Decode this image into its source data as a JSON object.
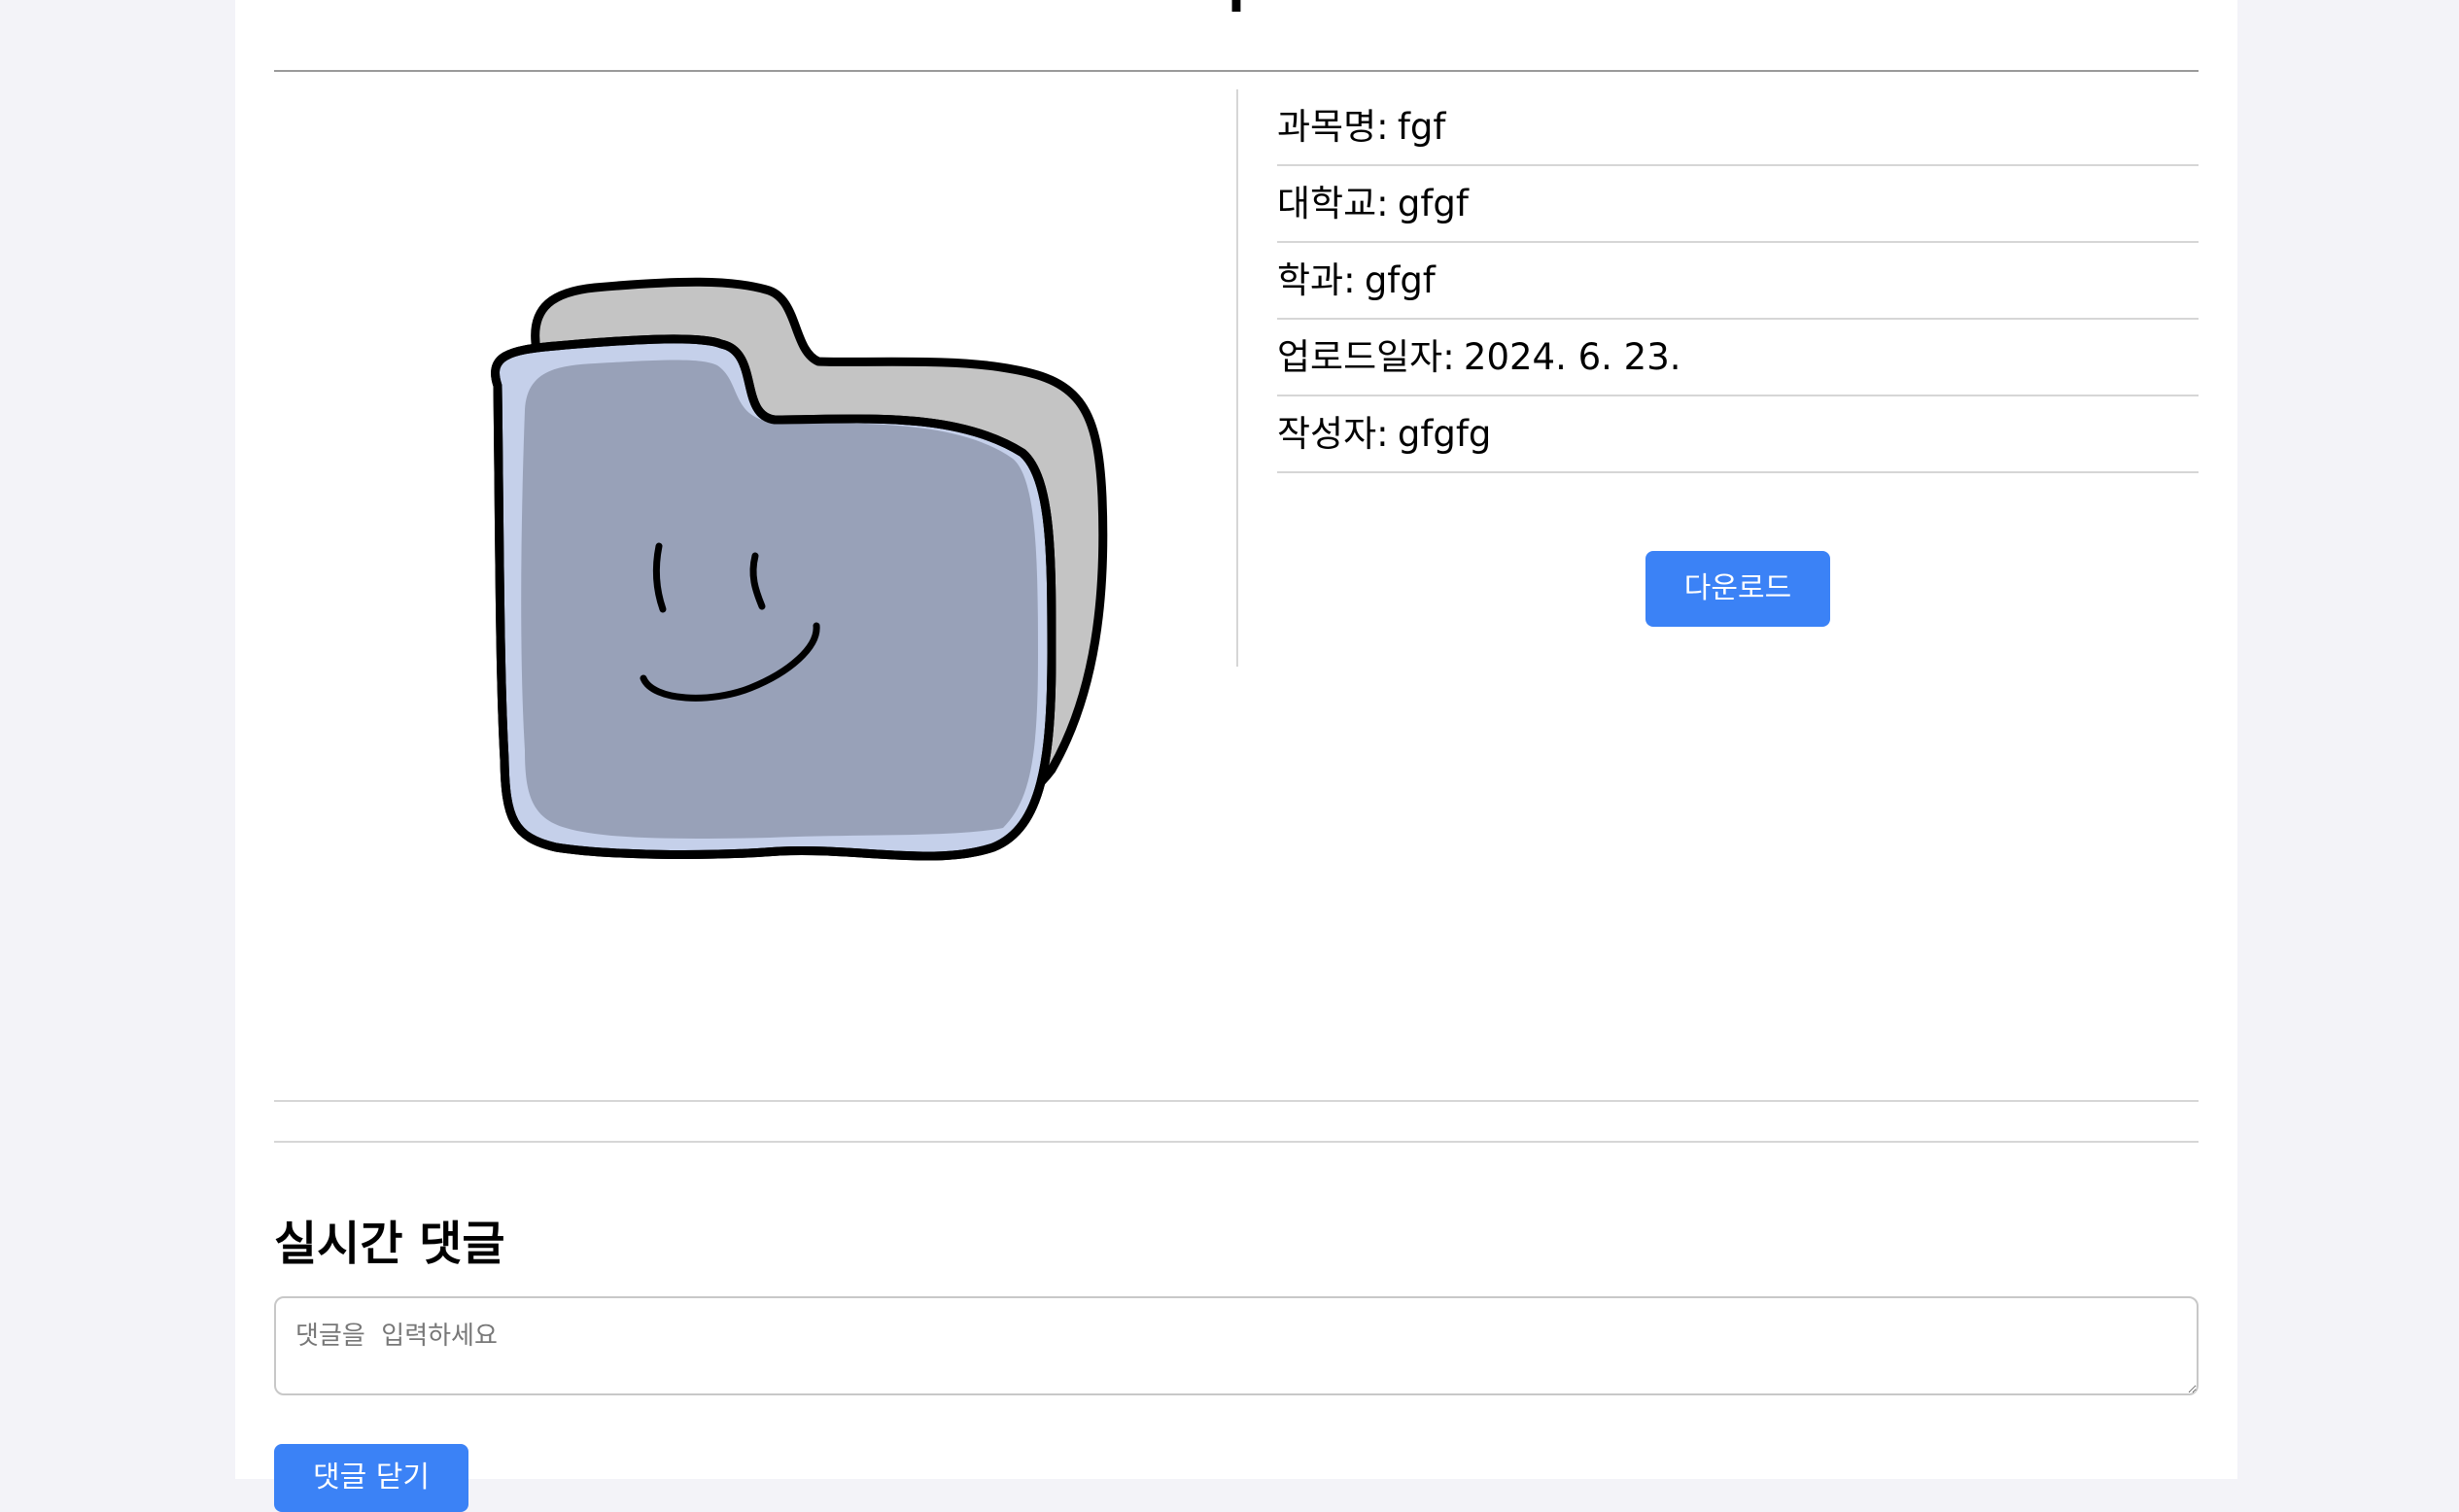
{
  "page": {
    "title": "|"
  },
  "preview": {
    "icon": "smiling-folder-icon",
    "colors": {
      "back": "#c4c4c4",
      "front": "#c5d0ea",
      "inner": "#98a1b8",
      "outline": "#000000"
    }
  },
  "details": {
    "rows": [
      {
        "label": "과목명",
        "value": "fgf"
      },
      {
        "label": "대학교",
        "value": "gfgf"
      },
      {
        "label": "학과",
        "value": "gfgf"
      },
      {
        "label": "업로드일자",
        "value": "2024. 6. 23."
      },
      {
        "label": "작성자",
        "value": "gfgfg"
      }
    ],
    "download_label": "다운로드"
  },
  "comments": {
    "title": "실시간 댓글",
    "placeholder": "댓글을  입력하세요",
    "value": "",
    "close_label": "댓글 닫기"
  },
  "colors": {
    "accent": "#3b82f6",
    "background": "#f3f3f8",
    "card": "#ffffff"
  }
}
